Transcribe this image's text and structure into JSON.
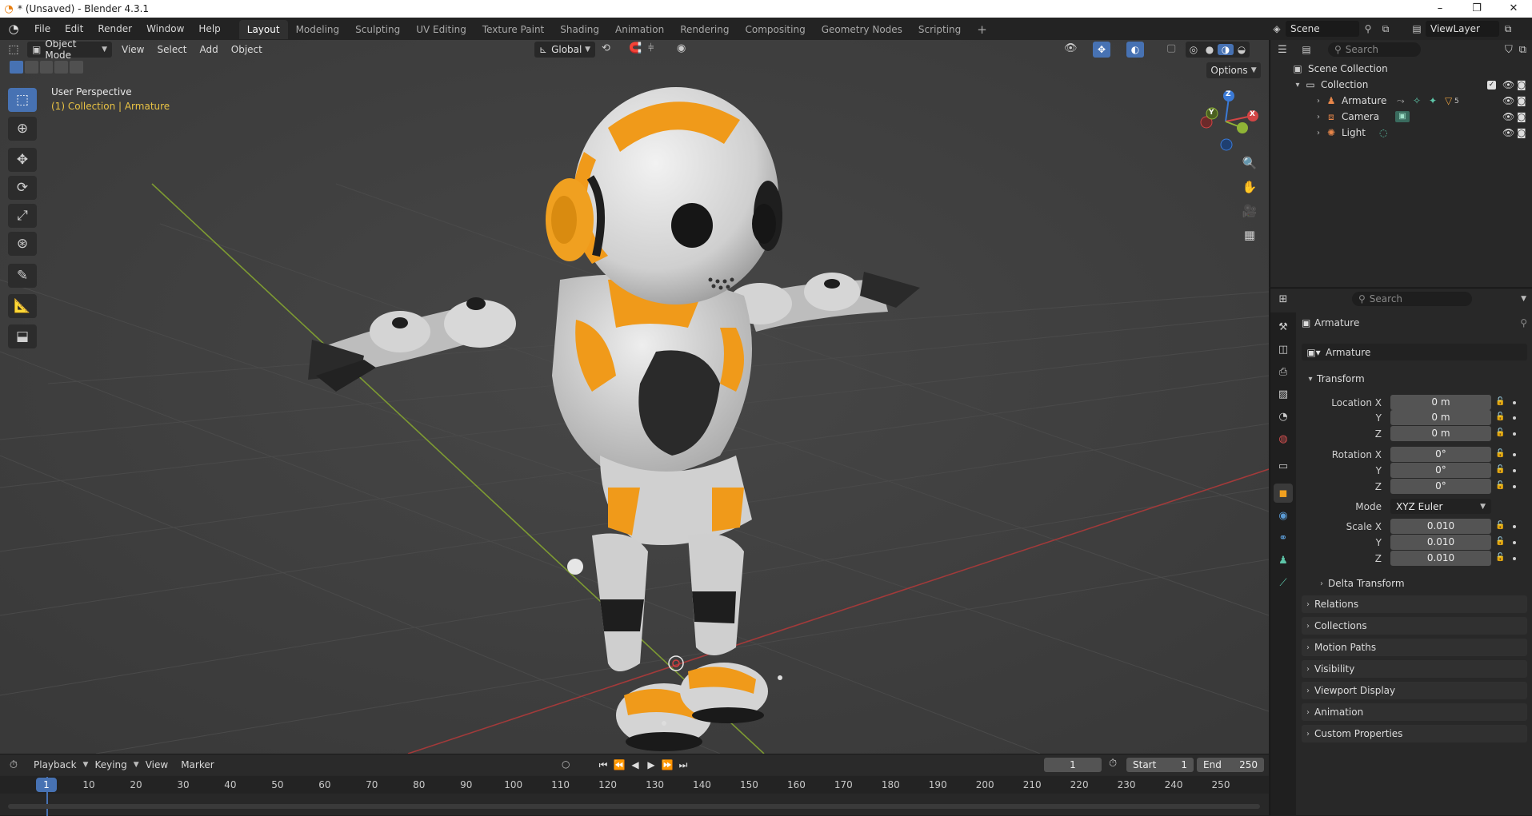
{
  "window": {
    "title": "* (Unsaved) - Blender 4.3.1",
    "minimize": "–",
    "maximize": "❐",
    "close": "✕"
  },
  "menus": [
    "File",
    "Edit",
    "Render",
    "Window",
    "Help"
  ],
  "workspaces": {
    "tabs": [
      "Layout",
      "Modeling",
      "Sculpting",
      "UV Editing",
      "Texture Paint",
      "Shading",
      "Animation",
      "Rendering",
      "Compositing",
      "Geometry Nodes",
      "Scripting"
    ],
    "active": "Layout",
    "add": "+"
  },
  "scene": {
    "name": "Scene",
    "view_layer": "ViewLayer"
  },
  "viewport": {
    "mode": "Object Mode",
    "menu": [
      "View",
      "Select",
      "Add",
      "Object"
    ],
    "orientation": "Global",
    "options": "Options",
    "perspective_label": "User Perspective",
    "collection_info": "(1) Collection | Armature",
    "gizmo": {
      "x": "X",
      "y": "Y",
      "z": "Z"
    }
  },
  "toolbar_icons": [
    "select-box-icon",
    "cursor-icon",
    "move-icon",
    "rotate-icon",
    "scale-icon",
    "transform-icon",
    "annotate-icon",
    "measure-icon",
    "add-cube-icon"
  ],
  "timeline": {
    "menu": [
      "Playback",
      "Keying",
      "View",
      "Marker"
    ],
    "current_frame": "1",
    "start_label": "Start",
    "start": "1",
    "end_label": "End",
    "end": "250",
    "ticks": [
      "1",
      "10",
      "20",
      "30",
      "40",
      "50",
      "60",
      "70",
      "80",
      "90",
      "100",
      "110",
      "120",
      "130",
      "140",
      "150",
      "160",
      "170",
      "180",
      "190",
      "200",
      "210",
      "220",
      "230",
      "240",
      "250"
    ]
  },
  "outliner": {
    "search_placeholder": "Search",
    "scene_collection": "Scene Collection",
    "collection": "Collection",
    "items": [
      {
        "name": "Armature",
        "modifier_count": "5"
      },
      {
        "name": "Camera"
      },
      {
        "name": "Light"
      }
    ]
  },
  "properties": {
    "search_placeholder": "Search",
    "object_name": "Armature",
    "data_name": "Armature",
    "transform": {
      "title": "Transform",
      "location": {
        "label_x": "Location X",
        "label_y": "Y",
        "label_z": "Z",
        "x": "0 m",
        "y": "0 m",
        "z": "0 m"
      },
      "rotation": {
        "label_x": "Rotation X",
        "label_y": "Y",
        "label_z": "Z",
        "x": "0°",
        "y": "0°",
        "z": "0°"
      },
      "mode_label": "Mode",
      "mode": "XYZ Euler",
      "scale": {
        "label_x": "Scale X",
        "label_y": "Y",
        "label_z": "Z",
        "x": "0.010",
        "y": "0.010",
        "z": "0.010"
      },
      "delta": "Delta Transform"
    },
    "panels": [
      "Relations",
      "Collections",
      "Motion Paths",
      "Visibility",
      "Viewport Display",
      "Animation",
      "Custom Properties"
    ]
  },
  "colors": {
    "accent_blue": "#4772b3",
    "axis_x": "#d34545",
    "axis_y": "#8fb436",
    "axis_z": "#3b7ad6",
    "orange": "#f0a020"
  }
}
